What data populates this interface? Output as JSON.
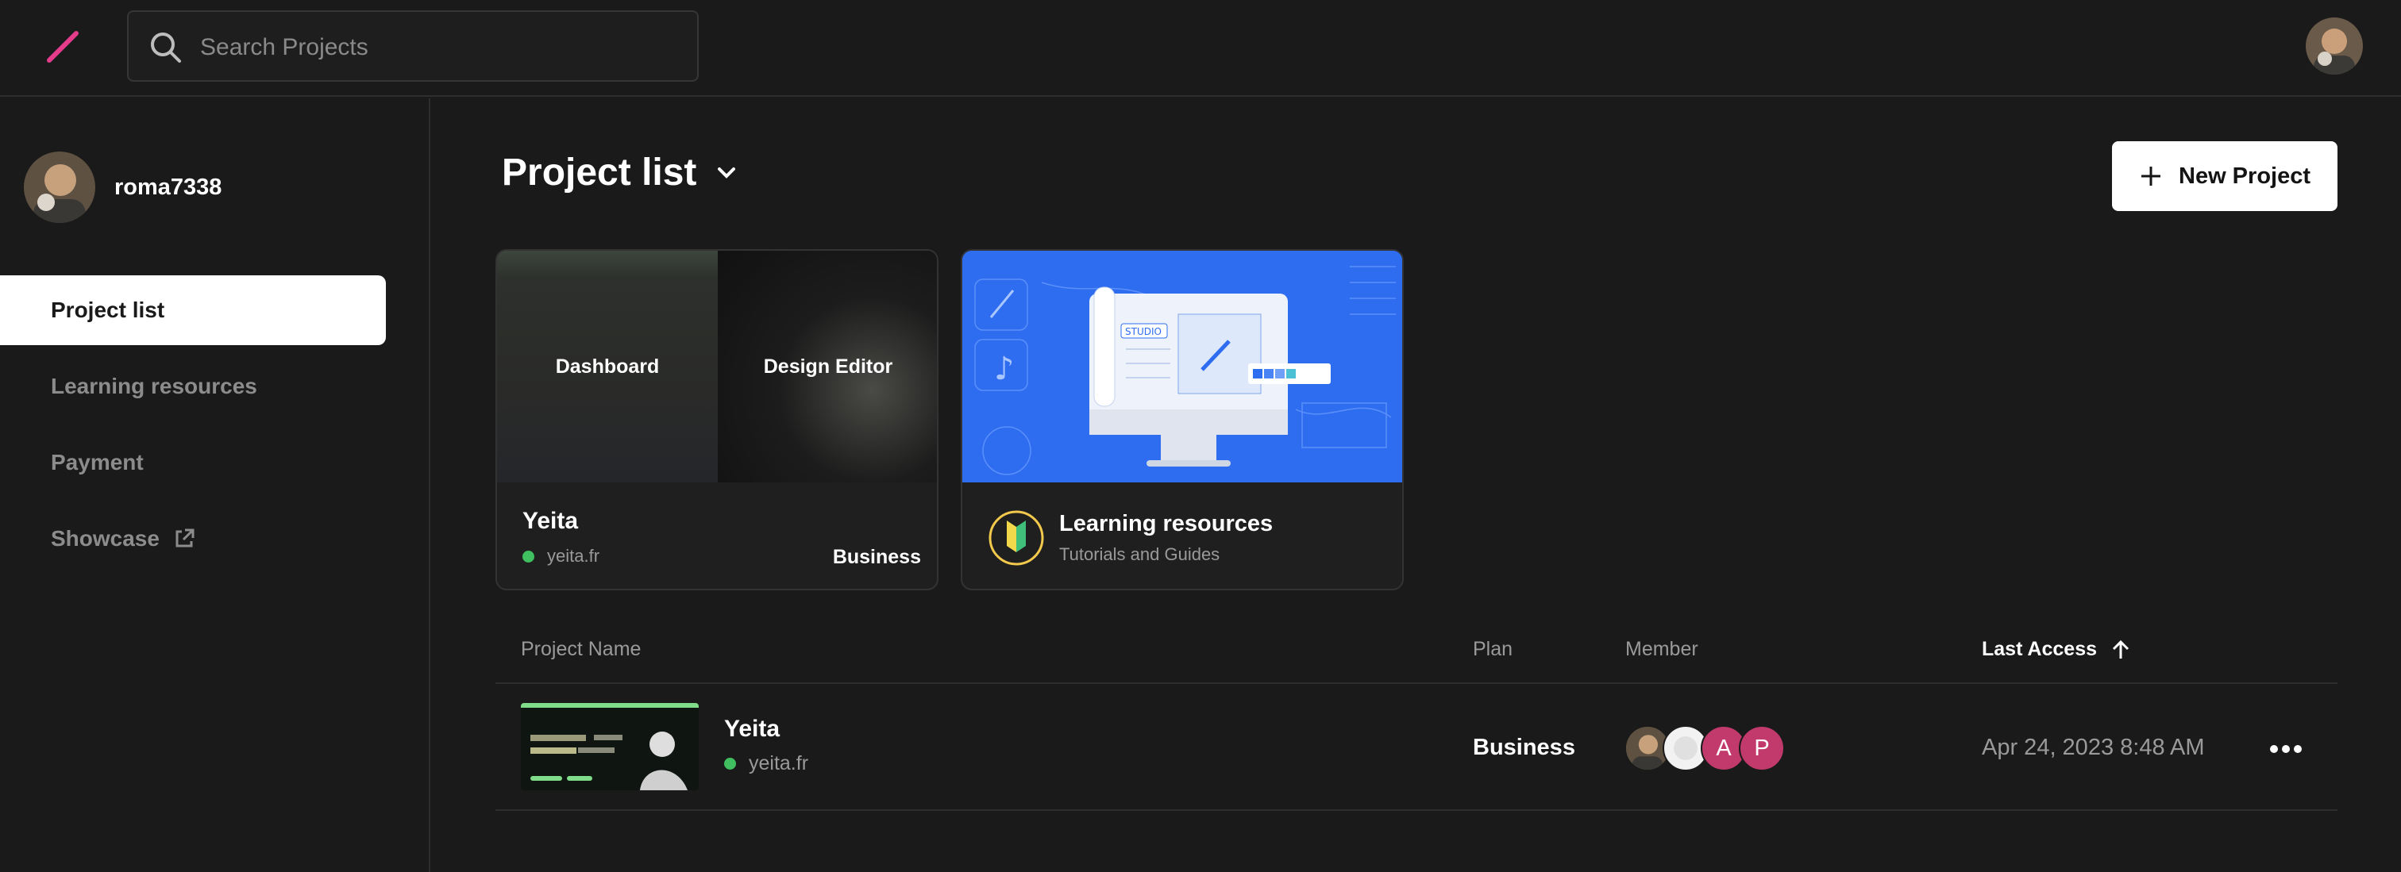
{
  "app": {
    "accent": "#e53c8c",
    "search_placeholder": "Search Projects"
  },
  "user": {
    "username": "roma7338"
  },
  "sidebar": {
    "items": [
      {
        "label": "Project list",
        "active": true
      },
      {
        "label": "Learning resources",
        "active": false
      },
      {
        "label": "Payment",
        "active": false
      },
      {
        "label": "Showcase",
        "active": false,
        "icon": "external-link-icon"
      }
    ]
  },
  "main": {
    "title": "Project list",
    "new_project_label": "New Project",
    "cards": {
      "project": {
        "left_label": "Dashboard",
        "right_label": "Design Editor",
        "name": "Yeita",
        "url": "yeita.fr",
        "status_color": "#3fbf5f",
        "plan": "Business"
      },
      "learning": {
        "title": "Learning resources",
        "subtitle": "Tutorials and Guides",
        "illustration_text": "STUDIO"
      }
    },
    "table": {
      "headers": {
        "name": "Project Name",
        "plan": "Plan",
        "member": "Member",
        "last_access": "Last Access"
      },
      "sort": {
        "column": "last_access",
        "direction": "ascending"
      },
      "rows": [
        {
          "name": "Yeita",
          "url": "yeita.fr",
          "plan": "Business",
          "members": [
            {
              "type": "photo"
            },
            {
              "type": "placeholder"
            },
            {
              "initial": "A",
              "color": "#c13a6b"
            },
            {
              "initial": "P",
              "color": "#c13a6b"
            }
          ],
          "last_access": "Apr 24, 2023 8:48 AM"
        }
      ]
    }
  }
}
